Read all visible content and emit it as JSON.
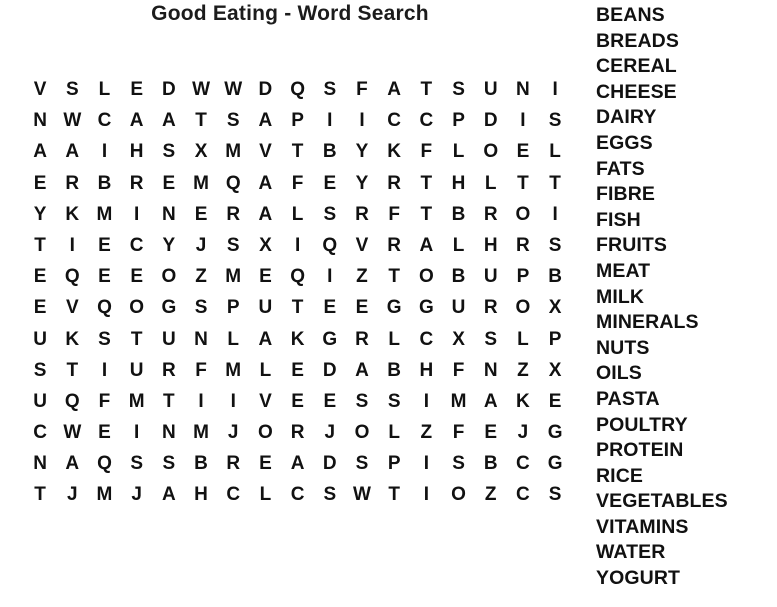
{
  "puzzle": {
    "title": "Good Eating - Word Search",
    "grid_rows": 14,
    "grid_cols": 17,
    "grid": [
      [
        "V",
        "S",
        "L",
        "E",
        "D",
        "W",
        "W",
        "D",
        "Q",
        "S",
        "F",
        "A",
        "T",
        "S",
        "U",
        "N",
        "I"
      ],
      [
        "N",
        "W",
        "C",
        "A",
        "A",
        "T",
        "S",
        "A",
        "P",
        "I",
        "I",
        "C",
        "C",
        "P",
        "D",
        "I",
        "S"
      ],
      [
        "A",
        "A",
        "I",
        "H",
        "S",
        "X",
        "M",
        "V",
        "T",
        "B",
        "Y",
        "K",
        "F",
        "L",
        "O",
        "E",
        "L"
      ],
      [
        "E",
        "R",
        "B",
        "R",
        "E",
        "M",
        "Q",
        "A",
        "F",
        "E",
        "Y",
        "R",
        "T",
        "H",
        "L",
        "T",
        "T"
      ],
      [
        "Y",
        "K",
        "M",
        "I",
        "N",
        "E",
        "R",
        "A",
        "L",
        "S",
        "R",
        "F",
        "T",
        "B",
        "R",
        "O",
        "I"
      ],
      [
        "T",
        "I",
        "E",
        "C",
        "Y",
        "J",
        "S",
        "X",
        "I",
        "Q",
        "V",
        "R",
        "A",
        "L",
        "H",
        "R",
        "S"
      ],
      [
        "E",
        "Q",
        "E",
        "E",
        "O",
        "Z",
        "M",
        "E",
        "Q",
        "I",
        "Z",
        "T",
        "O",
        "B",
        "U",
        "P",
        "B"
      ],
      [
        "E",
        "V",
        "Q",
        "O",
        "G",
        "S",
        "P",
        "U",
        "T",
        "E",
        "E",
        "G",
        "G",
        "U",
        "R",
        "O",
        "X"
      ],
      [
        "U",
        "K",
        "S",
        "T",
        "U",
        "N",
        "L",
        "A",
        "K",
        "G",
        "R",
        "L",
        "C",
        "X",
        "S",
        "L",
        "P"
      ],
      [
        "S",
        "T",
        "I",
        "U",
        "R",
        "F",
        "M",
        "L",
        "E",
        "D",
        "A",
        "B",
        "H",
        "F",
        "N",
        "Z",
        "X"
      ],
      [
        "U",
        "Q",
        "F",
        "M",
        "T",
        "I",
        "I",
        "V",
        "E",
        "E",
        "S",
        "S",
        "I",
        "M",
        "A",
        "K",
        "E"
      ],
      [
        "C",
        "W",
        "E",
        "I",
        "N",
        "M",
        "J",
        "O",
        "R",
        "J",
        "O",
        "L",
        "Z",
        "F",
        "E",
        "J",
        "G"
      ],
      [
        "N",
        "A",
        "Q",
        "S",
        "S",
        "B",
        "R",
        "E",
        "A",
        "D",
        "S",
        "P",
        "I",
        "S",
        "B",
        "C",
        "G"
      ],
      [
        "T",
        "J",
        "M",
        "J",
        "A",
        "H",
        "C",
        "L",
        "C",
        "S",
        "W",
        "T",
        "I",
        "O",
        "Z",
        "C",
        "S"
      ]
    ],
    "words": [
      "BEANS",
      "BREADS",
      "CEREAL",
      "CHEESE",
      "DAIRY",
      "EGGS",
      "FATS",
      "FIBRE",
      "FISH",
      "FRUITS",
      "MEAT",
      "MILK",
      "MINERALS",
      "NUTS",
      "OILS",
      "PASTA",
      "POULTRY",
      "PROTEIN",
      "RICE",
      "VEGETABLES",
      "VITAMINS",
      "WATER",
      "YOGURT"
    ]
  },
  "colors": {
    "text": "#111111",
    "background": "#ffffff"
  }
}
